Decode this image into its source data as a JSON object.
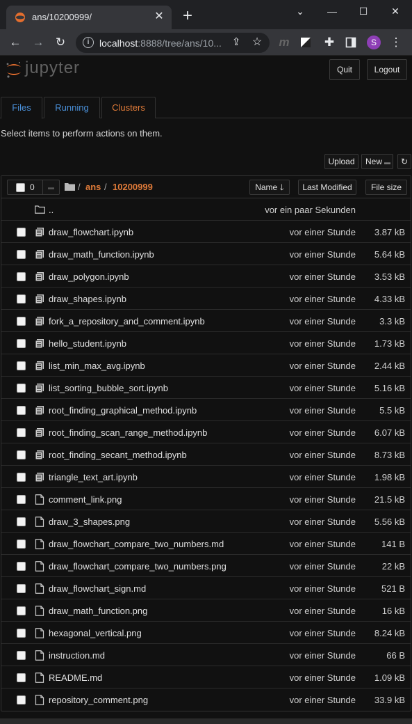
{
  "browser": {
    "tab_title": "ans/10200999/",
    "url_host": "localhost",
    "url_rest": ":8888/tree/ans/10...",
    "avatar_letter": "S",
    "ext_letter": "m"
  },
  "header": {
    "logo_text": "jupyter",
    "quit_label": "Quit",
    "logout_label": "Logout"
  },
  "tabs": [
    {
      "label": "Files",
      "color": "#4a90d9"
    },
    {
      "label": "Running",
      "color": "#4a90d9"
    },
    {
      "label": "Clusters",
      "color": "#e07b39"
    }
  ],
  "hint": "Select items to perform actions on them.",
  "actions": {
    "upload_label": "Upload",
    "new_label": "New",
    "refresh_icon": "refresh-icon"
  },
  "list_header": {
    "selected_count": "0",
    "breadcrumb_root": "ans",
    "breadcrumb_sep": "/",
    "breadcrumb_current": "10200999",
    "sort_name": "Name",
    "sort_modified": "Last Modified",
    "sort_size": "File size"
  },
  "parent_row": {
    "name": "..",
    "modified": "vor ein paar Sekunden"
  },
  "files": [
    {
      "name": "draw_flowchart.ipynb",
      "modified": "vor einer Stunde",
      "size": "3.87 kB",
      "kind": "notebook"
    },
    {
      "name": "draw_math_function.ipynb",
      "modified": "vor einer Stunde",
      "size": "5.64 kB",
      "kind": "notebook"
    },
    {
      "name": "draw_polygon.ipynb",
      "modified": "vor einer Stunde",
      "size": "3.53 kB",
      "kind": "notebook"
    },
    {
      "name": "draw_shapes.ipynb",
      "modified": "vor einer Stunde",
      "size": "4.33 kB",
      "kind": "notebook"
    },
    {
      "name": "fork_a_repository_and_comment.ipynb",
      "modified": "vor einer Stunde",
      "size": "3.3 kB",
      "kind": "notebook"
    },
    {
      "name": "hello_student.ipynb",
      "modified": "vor einer Stunde",
      "size": "1.73 kB",
      "kind": "notebook"
    },
    {
      "name": "list_min_max_avg.ipynb",
      "modified": "vor einer Stunde",
      "size": "2.44 kB",
      "kind": "notebook"
    },
    {
      "name": "list_sorting_bubble_sort.ipynb",
      "modified": "vor einer Stunde",
      "size": "5.16 kB",
      "kind": "notebook"
    },
    {
      "name": "root_finding_graphical_method.ipynb",
      "modified": "vor einer Stunde",
      "size": "5.5 kB",
      "kind": "notebook"
    },
    {
      "name": "root_finding_scan_range_method.ipynb",
      "modified": "vor einer Stunde",
      "size": "6.07 kB",
      "kind": "notebook"
    },
    {
      "name": "root_finding_secant_method.ipynb",
      "modified": "vor einer Stunde",
      "size": "8.73 kB",
      "kind": "notebook"
    },
    {
      "name": "triangle_text_art.ipynb",
      "modified": "vor einer Stunde",
      "size": "1.98 kB",
      "kind": "notebook"
    },
    {
      "name": "comment_link.png",
      "modified": "vor einer Stunde",
      "size": "21.5 kB",
      "kind": "file"
    },
    {
      "name": "draw_3_shapes.png",
      "modified": "vor einer Stunde",
      "size": "5.56 kB",
      "kind": "file"
    },
    {
      "name": "draw_flowchart_compare_two_numbers.md",
      "modified": "vor einer Stunde",
      "size": "141 B",
      "kind": "file"
    },
    {
      "name": "draw_flowchart_compare_two_numbers.png",
      "modified": "vor einer Stunde",
      "size": "22 kB",
      "kind": "file"
    },
    {
      "name": "draw_flowchart_sign.md",
      "modified": "vor einer Stunde",
      "size": "521 B",
      "kind": "file"
    },
    {
      "name": "draw_math_function.png",
      "modified": "vor einer Stunde",
      "size": "16 kB",
      "kind": "file"
    },
    {
      "name": "hexagonal_vertical.png",
      "modified": "vor einer Stunde",
      "size": "8.24 kB",
      "kind": "file"
    },
    {
      "name": "instruction.md",
      "modified": "vor einer Stunde",
      "size": "66 B",
      "kind": "file"
    },
    {
      "name": "README.md",
      "modified": "vor einer Stunde",
      "size": "1.09 kB",
      "kind": "file"
    },
    {
      "name": "repository_comment.png",
      "modified": "vor einer Stunde",
      "size": "33.9 kB",
      "kind": "file"
    }
  ],
  "colors": {
    "accent_orange": "#e07b39",
    "link_blue": "#4a90d9",
    "background": "#111111"
  }
}
